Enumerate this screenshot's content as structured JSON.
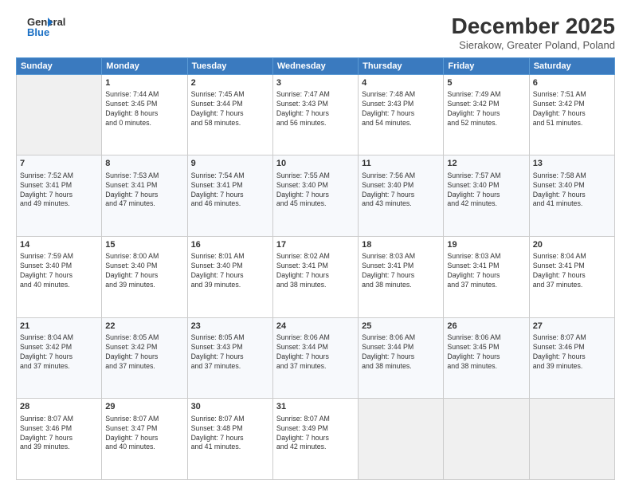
{
  "logo": {
    "line1": "General",
    "line2": "Blue"
  },
  "header": {
    "month": "December 2025",
    "location": "Sierakow, Greater Poland, Poland"
  },
  "days_of_week": [
    "Sunday",
    "Monday",
    "Tuesday",
    "Wednesday",
    "Thursday",
    "Friday",
    "Saturday"
  ],
  "weeks": [
    [
      {
        "day": "",
        "info": ""
      },
      {
        "day": "1",
        "info": "Sunrise: 7:44 AM\nSunset: 3:45 PM\nDaylight: 8 hours\nand 0 minutes."
      },
      {
        "day": "2",
        "info": "Sunrise: 7:45 AM\nSunset: 3:44 PM\nDaylight: 7 hours\nand 58 minutes."
      },
      {
        "day": "3",
        "info": "Sunrise: 7:47 AM\nSunset: 3:43 PM\nDaylight: 7 hours\nand 56 minutes."
      },
      {
        "day": "4",
        "info": "Sunrise: 7:48 AM\nSunset: 3:43 PM\nDaylight: 7 hours\nand 54 minutes."
      },
      {
        "day": "5",
        "info": "Sunrise: 7:49 AM\nSunset: 3:42 PM\nDaylight: 7 hours\nand 52 minutes."
      },
      {
        "day": "6",
        "info": "Sunrise: 7:51 AM\nSunset: 3:42 PM\nDaylight: 7 hours\nand 51 minutes."
      }
    ],
    [
      {
        "day": "7",
        "info": "Sunrise: 7:52 AM\nSunset: 3:41 PM\nDaylight: 7 hours\nand 49 minutes."
      },
      {
        "day": "8",
        "info": "Sunrise: 7:53 AM\nSunset: 3:41 PM\nDaylight: 7 hours\nand 47 minutes."
      },
      {
        "day": "9",
        "info": "Sunrise: 7:54 AM\nSunset: 3:41 PM\nDaylight: 7 hours\nand 46 minutes."
      },
      {
        "day": "10",
        "info": "Sunrise: 7:55 AM\nSunset: 3:40 PM\nDaylight: 7 hours\nand 45 minutes."
      },
      {
        "day": "11",
        "info": "Sunrise: 7:56 AM\nSunset: 3:40 PM\nDaylight: 7 hours\nand 43 minutes."
      },
      {
        "day": "12",
        "info": "Sunrise: 7:57 AM\nSunset: 3:40 PM\nDaylight: 7 hours\nand 42 minutes."
      },
      {
        "day": "13",
        "info": "Sunrise: 7:58 AM\nSunset: 3:40 PM\nDaylight: 7 hours\nand 41 minutes."
      }
    ],
    [
      {
        "day": "14",
        "info": "Sunrise: 7:59 AM\nSunset: 3:40 PM\nDaylight: 7 hours\nand 40 minutes."
      },
      {
        "day": "15",
        "info": "Sunrise: 8:00 AM\nSunset: 3:40 PM\nDaylight: 7 hours\nand 39 minutes."
      },
      {
        "day": "16",
        "info": "Sunrise: 8:01 AM\nSunset: 3:40 PM\nDaylight: 7 hours\nand 39 minutes."
      },
      {
        "day": "17",
        "info": "Sunrise: 8:02 AM\nSunset: 3:41 PM\nDaylight: 7 hours\nand 38 minutes."
      },
      {
        "day": "18",
        "info": "Sunrise: 8:03 AM\nSunset: 3:41 PM\nDaylight: 7 hours\nand 38 minutes."
      },
      {
        "day": "19",
        "info": "Sunrise: 8:03 AM\nSunset: 3:41 PM\nDaylight: 7 hours\nand 37 minutes."
      },
      {
        "day": "20",
        "info": "Sunrise: 8:04 AM\nSunset: 3:41 PM\nDaylight: 7 hours\nand 37 minutes."
      }
    ],
    [
      {
        "day": "21",
        "info": "Sunrise: 8:04 AM\nSunset: 3:42 PM\nDaylight: 7 hours\nand 37 minutes."
      },
      {
        "day": "22",
        "info": "Sunrise: 8:05 AM\nSunset: 3:42 PM\nDaylight: 7 hours\nand 37 minutes."
      },
      {
        "day": "23",
        "info": "Sunrise: 8:05 AM\nSunset: 3:43 PM\nDaylight: 7 hours\nand 37 minutes."
      },
      {
        "day": "24",
        "info": "Sunrise: 8:06 AM\nSunset: 3:44 PM\nDaylight: 7 hours\nand 37 minutes."
      },
      {
        "day": "25",
        "info": "Sunrise: 8:06 AM\nSunset: 3:44 PM\nDaylight: 7 hours\nand 38 minutes."
      },
      {
        "day": "26",
        "info": "Sunrise: 8:06 AM\nSunset: 3:45 PM\nDaylight: 7 hours\nand 38 minutes."
      },
      {
        "day": "27",
        "info": "Sunrise: 8:07 AM\nSunset: 3:46 PM\nDaylight: 7 hours\nand 39 minutes."
      }
    ],
    [
      {
        "day": "28",
        "info": "Sunrise: 8:07 AM\nSunset: 3:46 PM\nDaylight: 7 hours\nand 39 minutes."
      },
      {
        "day": "29",
        "info": "Sunrise: 8:07 AM\nSunset: 3:47 PM\nDaylight: 7 hours\nand 40 minutes."
      },
      {
        "day": "30",
        "info": "Sunrise: 8:07 AM\nSunset: 3:48 PM\nDaylight: 7 hours\nand 41 minutes."
      },
      {
        "day": "31",
        "info": "Sunrise: 8:07 AM\nSunset: 3:49 PM\nDaylight: 7 hours\nand 42 minutes."
      },
      {
        "day": "",
        "info": ""
      },
      {
        "day": "",
        "info": ""
      },
      {
        "day": "",
        "info": ""
      }
    ]
  ]
}
